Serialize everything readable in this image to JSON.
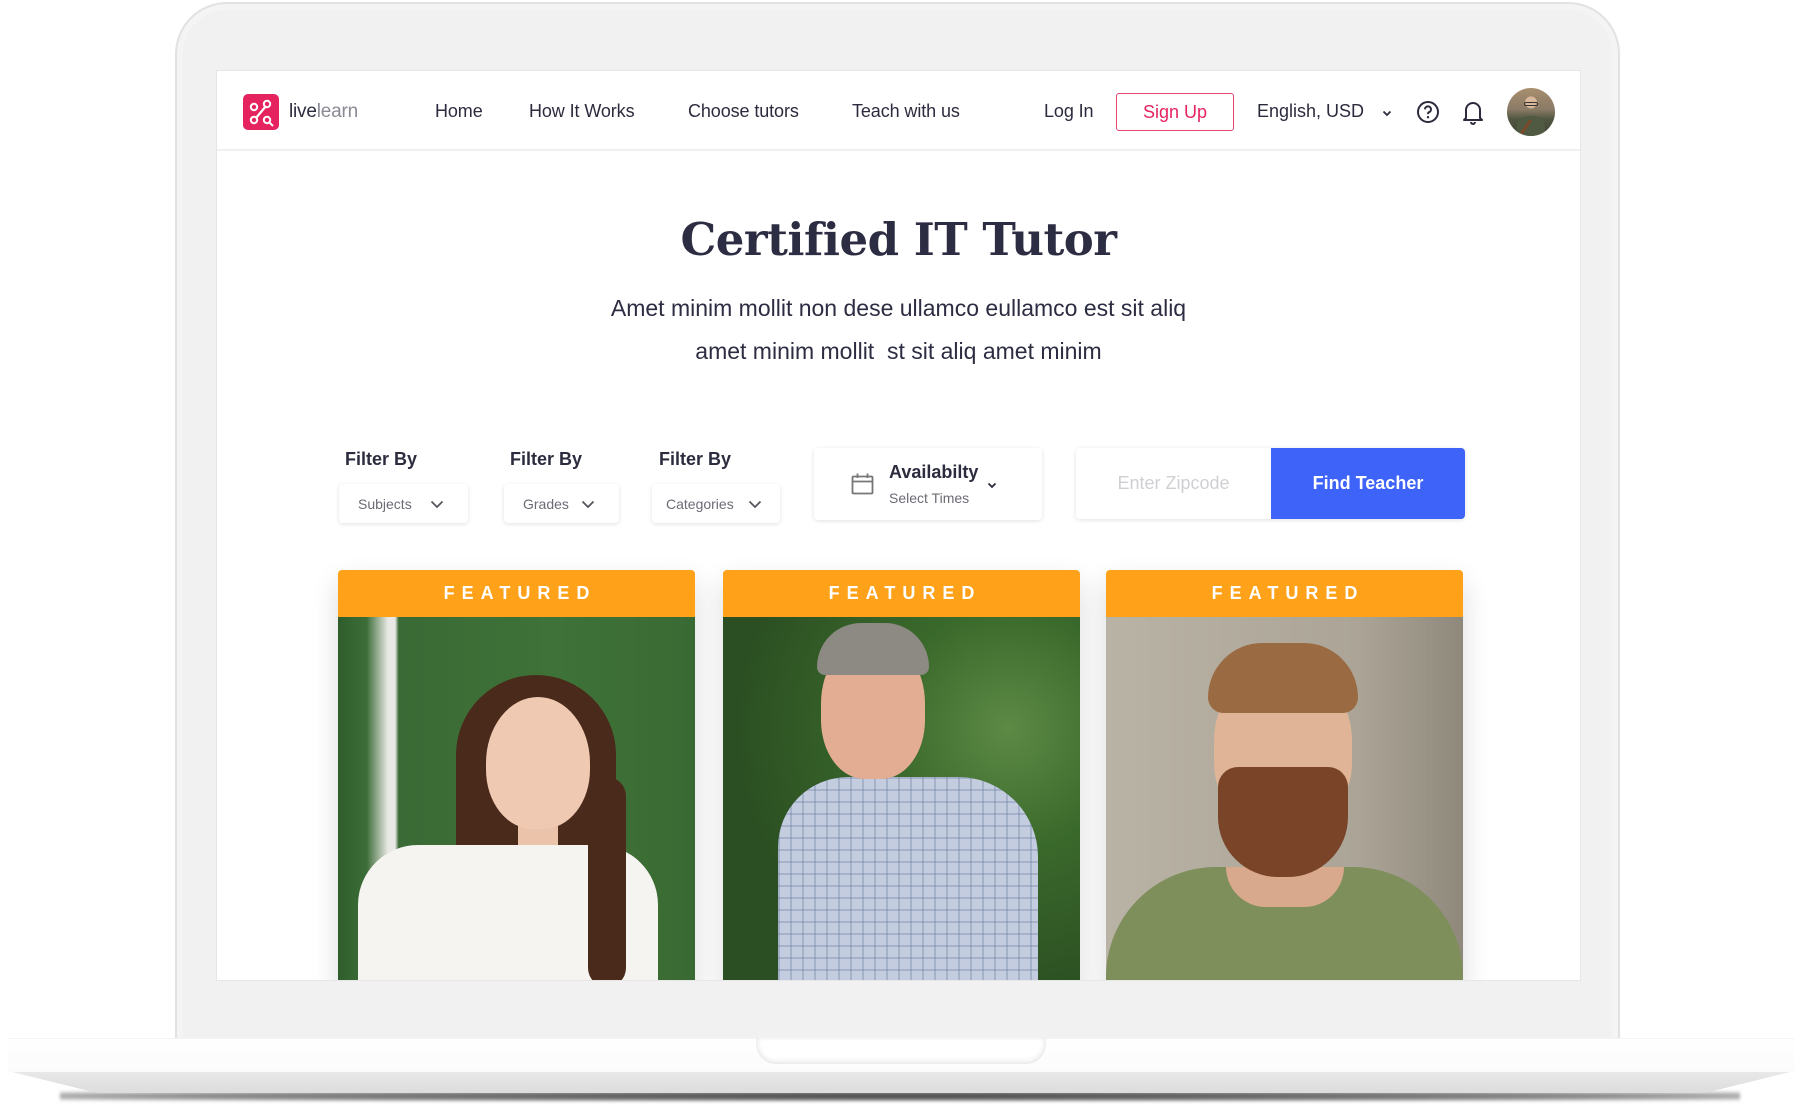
{
  "app": {
    "logo_primary": "live",
    "logo_secondary": "learn",
    "brand_color": "#e4235f"
  },
  "header": {
    "nav": [
      {
        "label": "Home"
      },
      {
        "label": "How It Works"
      },
      {
        "label": "Choose tutors"
      },
      {
        "label": "Teach with us"
      }
    ],
    "login_label": "Log In",
    "signup_label": "Sign Up",
    "language_currency": "English, USD",
    "icons": [
      "help-circle-icon",
      "bell-icon",
      "user-avatar"
    ]
  },
  "hero": {
    "title": "Certified IT Tutor",
    "subtitle_line1": "Amet minim mollit non dese ullamco eullamco est sit aliq",
    "subtitle_line2": "amet minim mollit  st sit aliq amet minim"
  },
  "filters": {
    "items": [
      {
        "label": "Filter By",
        "value": "Subjects"
      },
      {
        "label": "Filter By",
        "value": "Grades"
      },
      {
        "label": "Filter By",
        "value": "Categories"
      }
    ],
    "availability": {
      "title": "Availabilty",
      "subtitle": "Select Times"
    },
    "zipcode_placeholder": "Enter Zipcode",
    "zipcode_value": "",
    "find_button": "Find Teacher",
    "find_button_color": "#3e63f9"
  },
  "cards": {
    "badge_color": "#ffa21a",
    "items": [
      {
        "badge": "FEATURED",
        "photo": "female-tutor-chalkboard"
      },
      {
        "badge": "FEATURED",
        "photo": "male-tutor-outdoors"
      },
      {
        "badge": "FEATURED",
        "photo": "bearded-male-tutor"
      }
    ]
  }
}
